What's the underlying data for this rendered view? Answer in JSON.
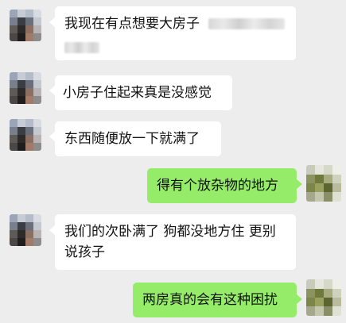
{
  "colors": {
    "background": "#ededed",
    "incoming_bubble": "#ffffff",
    "outgoing_bubble": "#95ec69"
  },
  "messages": [
    {
      "side": "left",
      "text": "我现在有点想要大房子"
    },
    {
      "side": "left",
      "text": "小房子住起来真是没感觉"
    },
    {
      "side": "left",
      "text": "东西随便放一下就满了"
    },
    {
      "side": "right",
      "text": "得有个放杂物的地方"
    },
    {
      "side": "left",
      "line1": "我们的次卧满了 狗都没地方住 更别",
      "line2": "说孩子"
    },
    {
      "side": "right",
      "text": "两房真的会有这种困扰"
    }
  ]
}
